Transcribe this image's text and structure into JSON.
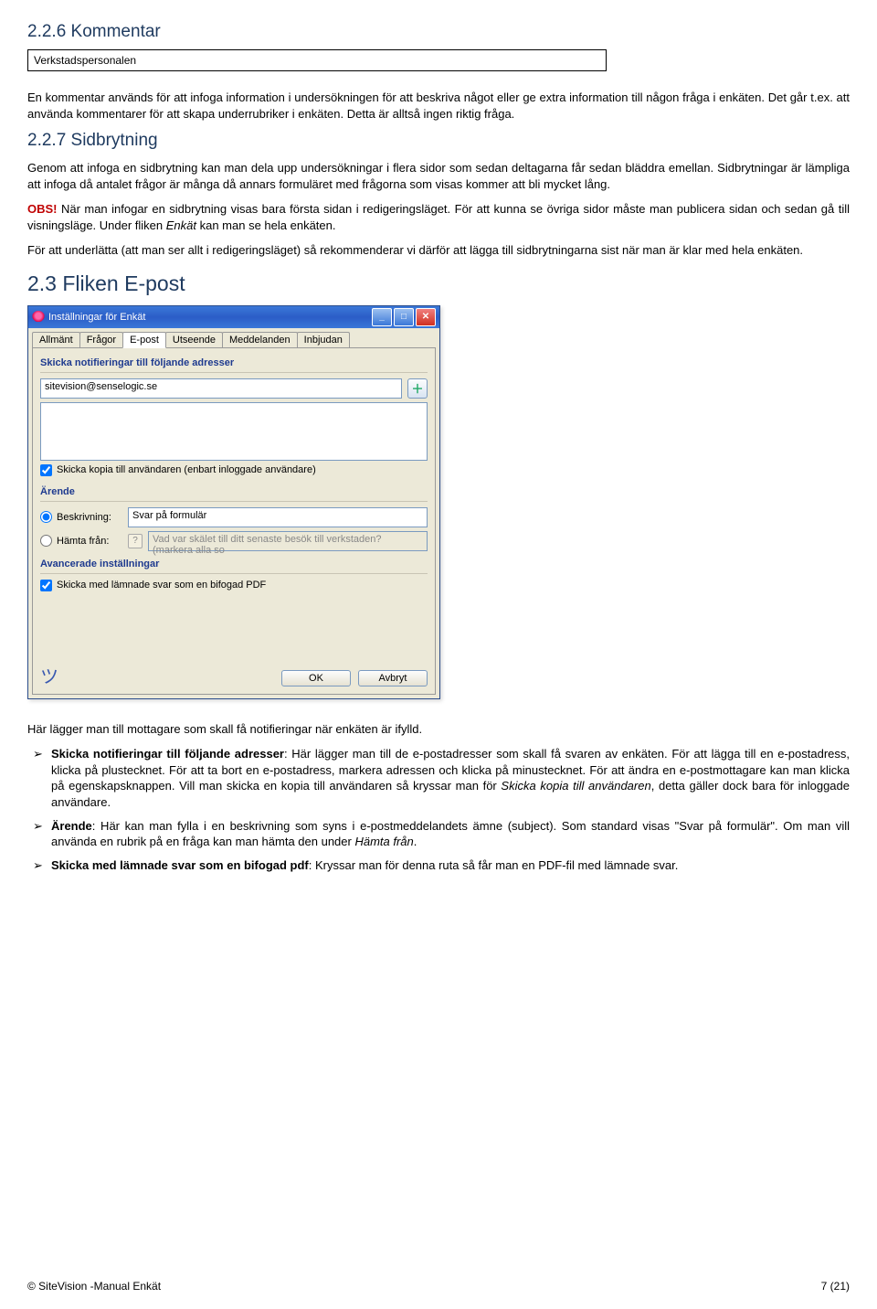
{
  "h_226": "2.2.6 Kommentar",
  "input_kommentar": "Verkstadspersonalen",
  "p_kommentar": "En kommentar används för att infoga information i undersökningen för att beskriva något eller ge extra information till någon fråga i enkäten. Det går t.ex. att använda kommentarer för att skapa underrubriker i enkäten. Detta är alltså ingen riktig fråga.",
  "h_227": "2.2.7 Sidbrytning",
  "p_sid1": "Genom att infoga en sidbrytning kan man dela upp undersökningar i flera sidor som sedan deltagarna får sedan bläddra emellan. Sidbrytningar är lämpliga att infoga då antalet frågor är många då annars formuläret med frågorna som visas kommer att bli mycket lång.",
  "p_obs_label": "OBS!",
  "p_obs_text": " När man infogar en sidbrytning visas bara första sidan i redigeringsläget. För att kunna se övriga sidor måste man publicera sidan och sedan gå till visningsläge. Under fliken ",
  "p_obs_italic": "Enkät",
  "p_obs_text2": " kan man se hela enkäten.",
  "p_sid2": "För att underlätta (att man ser allt i redigeringsläget) så rekommenderar vi därför att lägga till sidbrytningarna sist när man är klar med hela enkäten.",
  "h_23": "2.3 Fliken E-post",
  "dialog": {
    "title": "Inställningar för Enkät",
    "tabs": [
      "Allmänt",
      "Frågor",
      "E-post",
      "Utseende",
      "Meddelanden",
      "Inbjudan"
    ],
    "active_tab": 2,
    "group1_title": "Skicka notifieringar till följande adresser",
    "email_value": "sitevision@senselogic.se",
    "chk_copy": "Skicka kopia till användaren (enbart inloggade användare)",
    "group2_title": "Ärende",
    "radio_beskr": "Beskrivning:",
    "beskr_value": "Svar på formulär",
    "radio_hamta": "Hämta från:",
    "hamta_value": "Vad var skälet till ditt senaste besök till verkstaden? (markera alla so",
    "group3_title": "Avancerade inställningar",
    "chk_pdf": "Skicka med lämnade svar som en bifogad PDF",
    "btn_ok": "OK",
    "btn_cancel": "Avbryt"
  },
  "p_epost_intro": "Här lägger man till mottagare som skall få notifieringar när enkäten är ifylld.",
  "bullets": [
    {
      "lead": "Skicka notifieringar till följande adresser",
      "text": ": Här lägger man till de e-postadresser som skall få svaren av enkäten. För att lägga till en e-postadress, klicka på plustecknet. För att ta bort en e-postadress, markera adressen och klicka på minustecknet. För att ändra en e-postmottagare kan man klicka på egenskapsknappen.  Vill man skicka en kopia till användaren så kryssar man för ",
      "it1": "Skicka kopia till användaren",
      "text2": ", detta gäller dock bara för inloggade användare."
    },
    {
      "lead": "Ärende",
      "text": ": Här kan man fylla i en beskrivning som syns i e-postmeddelandets ämne (subject). Som standard visas \"Svar på formulär\". Om man vill använda en rubrik på en fråga kan man hämta den under  ",
      "it1": "Hämta från",
      "text2": "."
    },
    {
      "lead": "Skicka med lämnade svar som en bifogad pdf",
      "text": ":  Kryssar man för denna ruta så får man en PDF-fil med lämnade svar.",
      "it1": "",
      "text2": ""
    }
  ],
  "footer_left": "© SiteVision -Manual Enkät",
  "footer_right": "7 (21)"
}
